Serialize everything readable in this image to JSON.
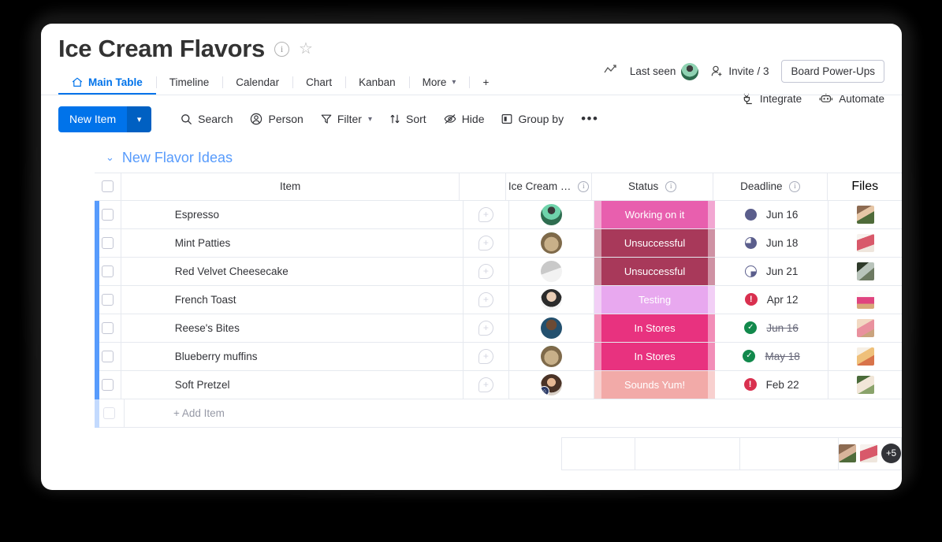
{
  "header": {
    "board_title": "Ice Cream Flavors",
    "info_icon": "info-icon",
    "star_icon": "star-icon",
    "trend_icon": "activity-icon",
    "last_seen_label": "Last seen",
    "invite_label": "Invite / 3",
    "power_ups_label": "Board Power-Ups",
    "integrate_label": "Integrate",
    "automate_label": "Automate"
  },
  "tabs": [
    {
      "label": "Main Table",
      "icon": "home-icon",
      "active": true
    },
    {
      "label": "Timeline",
      "active": false
    },
    {
      "label": "Calendar",
      "active": false
    },
    {
      "label": "Chart",
      "active": false
    },
    {
      "label": "Kanban",
      "active": false
    },
    {
      "label": "More",
      "active": false
    },
    {
      "label": "+",
      "active": false
    }
  ],
  "toolbar": {
    "new_item_label": "New Item",
    "new_item_caret": "⌄",
    "search_label": "Search",
    "person_label": "Person",
    "filter_label": "Filter",
    "sort_label": "Sort",
    "hide_label": "Hide",
    "group_by_label": "Group by",
    "more_label": "•••"
  },
  "group": {
    "name": "New Flavor Ideas",
    "caret": "⌄",
    "color": "#579bfc"
  },
  "table": {
    "columns": [
      "Item",
      "Ice Cream …",
      "Status",
      "Deadline",
      "Files"
    ],
    "add_item_label": "+ Add Item",
    "rows": [
      {
        "item": "Espresso",
        "status": "Working on it",
        "status_color": "#e85fae",
        "deadline": "Jun 16",
        "deadline_done": false,
        "deadline_icon": "circle-full-icon",
        "avatar": "avatar-1"
      },
      {
        "item": "Mint Patties",
        "status": "Unsuccessful",
        "status_color": "#a8395a",
        "deadline": "Jun 18",
        "deadline_done": false,
        "deadline_icon": "circle-three-quarter-icon",
        "avatar": "avatar-2"
      },
      {
        "item": "Red Velvet Cheesecake",
        "status": "Unsuccessful",
        "status_color": "#a8395a",
        "deadline": "Jun 21",
        "deadline_done": false,
        "deadline_icon": "circle-quarter-icon",
        "avatar": "avatar-3"
      },
      {
        "item": "French Toast",
        "status": "Testing",
        "status_color": "#e8a8ef",
        "deadline": "Apr 12",
        "deadline_done": false,
        "deadline_icon": "alert-icon",
        "avatar": "avatar-4"
      },
      {
        "item": "Reese's Bites",
        "status": "In Stores",
        "status_color": "#e8327f",
        "deadline": "Jun 16",
        "deadline_done": true,
        "deadline_icon": "check-icon",
        "avatar": "avatar-5"
      },
      {
        "item": "Blueberry muffins",
        "status": "In Stores",
        "status_color": "#e8327f",
        "deadline": "May 18",
        "deadline_done": true,
        "deadline_icon": "check-icon",
        "avatar": "avatar-2"
      },
      {
        "item": "Soft Pretzel",
        "status": "Sounds Yum!",
        "status_color": "#f2aaa8",
        "deadline": "Feb 22",
        "deadline_done": false,
        "deadline_icon": "alert-icon",
        "avatar": "avatar-6"
      }
    ],
    "summary": {
      "files_overflow": "+5"
    }
  },
  "colors": {
    "accent": "#0073ea",
    "group": "#579bfc",
    "working_on_it": "#e85fae",
    "unsuccessful": "#a8395a",
    "testing": "#e8a8ef",
    "in_stores": "#e8327f",
    "sounds_yum": "#f2aaa8",
    "done_green": "#12894c",
    "alert_red": "#d9304f",
    "deadline_slate": "#5b5e8c"
  }
}
